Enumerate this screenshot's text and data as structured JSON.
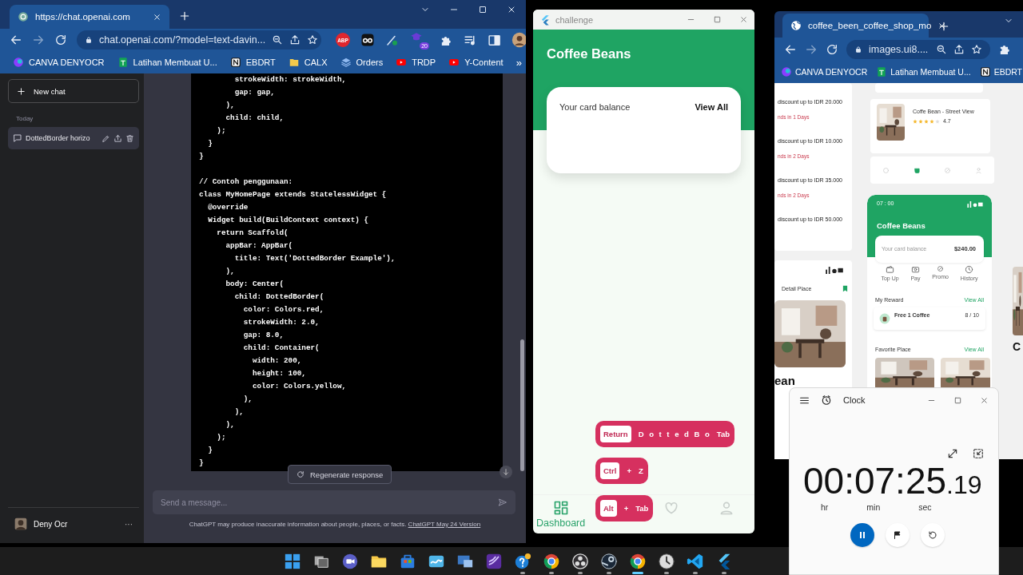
{
  "chat_browser": {
    "tab": {
      "title": "https://chat.openai.com"
    },
    "address": "chat.openai.com/?model=text-davin...",
    "extensions": [
      {
        "kind": "abp",
        "label": "ABP"
      },
      {
        "kind": "reader"
      },
      {
        "kind": "pen"
      },
      {
        "kind": "hat",
        "label": "20"
      },
      {
        "kind": "puzzle"
      },
      {
        "kind": "playlist"
      },
      {
        "kind": "sidepanel"
      },
      {
        "kind": "avatar"
      }
    ],
    "bookmarks": [
      {
        "kind": "canva",
        "label": "CANVA DENYOCR"
      },
      {
        "kind": "sheets",
        "label": "Latihan Membuat U..."
      },
      {
        "kind": "notion",
        "label": "EBDRT"
      },
      {
        "kind": "folder",
        "label": "CALX"
      },
      {
        "kind": "layers",
        "label": "Orders"
      },
      {
        "kind": "youtube",
        "label": "TRDP"
      },
      {
        "kind": "youtube",
        "label": "Y-Content"
      }
    ],
    "bookmarks_more": "»"
  },
  "chatgpt": {
    "new_chat": "New chat",
    "section": "Today",
    "chats": [
      {
        "title": "DottedBorder horizo",
        "selected": true
      }
    ],
    "user": "Deny Ocr",
    "user_menu": "···",
    "code": [
      [
        "        strokeWidth: strokeWidth,",
        "        gap: gap,",
        "      ),",
        "      child: child,",
        "    );",
        "  }",
        "}"
      ],
      [
        "// Contoh penggunaan:",
        "class MyHomePage extends StatelessWidget {",
        "  @override",
        "  Widget build(BuildContext context) {",
        "    return Scaffold(",
        "      appBar: AppBar(",
        "        title: Text('DottedBorder Example'),",
        "      ),",
        "      body: Center(",
        "        child: DottedBorder(",
        "          color: Colors.red,",
        "          strokeWidth: 2.0,",
        "          gap: 8.0,",
        "          child: Container(",
        "            width: 200,",
        "            height: 100,",
        "            color: Colors.yellow,",
        "          ),",
        "        ),",
        "      ),",
        "    );",
        "  }",
        "}"
      ]
    ],
    "regenerate": "Regenerate response",
    "input": {
      "placeholder": "Send a message..."
    },
    "disclaimer": "ChatGPT may produce inaccurate information about people, places, or facts.",
    "version_link": "ChatGPT May 24 Version"
  },
  "flutter_window": {
    "title": "challenge",
    "app_title": "Coffee Beans",
    "balance_label": "Your card balance",
    "view_all": "View All",
    "nav": [
      {
        "kind": "dashboard",
        "label": "Dashboard",
        "selected": true
      },
      {
        "kind": "heart",
        "selected": false
      },
      {
        "kind": "user",
        "selected": false
      }
    ],
    "key_overlays": [
      [
        {
          "kind": "key",
          "text": "Return"
        },
        {
          "kind": "text",
          "text": "D o t t e d B o"
        },
        {
          "kind": "text",
          "text": "Tab"
        }
      ],
      [
        {
          "kind": "key",
          "text": "Ctrl"
        },
        {
          "kind": "text",
          "text": "+"
        },
        {
          "kind": "text",
          "text": "Z"
        }
      ],
      [
        {
          "kind": "key",
          "text": "Alt"
        },
        {
          "kind": "text",
          "text": "+"
        },
        {
          "kind": "text",
          "text": "Tab"
        }
      ]
    ]
  },
  "mockup_browser": {
    "tab": {
      "title": "coffee_been_coffee_shop_mo"
    },
    "address": "images.ui8....",
    "bookmarks": [
      {
        "kind": "canva",
        "label": "CANVA DENYOCR"
      },
      {
        "kind": "sheets",
        "label": "Latihan Membuat U..."
      },
      {
        "kind": "notion",
        "label": "EBDRT"
      }
    ],
    "mockup": {
      "promos": [
        {
          "title": "discount up to IDR 20.000",
          "expiry": "nds in 1 Days"
        },
        {
          "title": "discount up to IDR 10.000",
          "expiry": "nds in 2 Days"
        },
        {
          "title": "discount up to IDR 35.000",
          "expiry": "nds in 2 Days"
        },
        {
          "title": "discount up to IDR 50.000"
        }
      ],
      "detail_title": "Detail Place",
      "detail_caption": "ean",
      "place": {
        "name": "Coffe Bean - Street View",
        "stars": 4,
        "rating": "4.7"
      },
      "nav": [
        {
          "kind": "home",
          "selected": false
        },
        {
          "kind": "cup",
          "selected": true
        },
        {
          "kind": "promo",
          "selected": false
        },
        {
          "kind": "user",
          "selected": false
        }
      ],
      "phone": {
        "time": "07 : 00",
        "title": "Coffee Beans",
        "balance_label": "Your card balance",
        "balance": "$240.00",
        "actions": [
          {
            "kind": "wallet",
            "label": "Top Up"
          },
          {
            "kind": "card",
            "label": "Pay"
          },
          {
            "kind": "promo",
            "label": "Promo"
          },
          {
            "kind": "clock",
            "label": "History"
          }
        ],
        "reward_title": "My Reward",
        "reward_link": "View All",
        "reward": {
          "name": "Free 1 Coffee",
          "progress": "8 / 10"
        },
        "favorites_title": "Favorite Place",
        "favorites_link": "View All"
      },
      "edge_caption": "C"
    }
  },
  "clock": {
    "title": "Clock",
    "time": "00:07:25",
    "fraction": ".19",
    "units": [
      "hr",
      "min",
      "sec"
    ],
    "running": true
  },
  "taskbar": {
    "apps": [
      {
        "kind": "windows",
        "open": false,
        "selected": false
      },
      {
        "kind": "taskview",
        "open": false,
        "selected": false
      },
      {
        "kind": "teams",
        "open": false,
        "selected": false
      },
      {
        "kind": "files",
        "open": false,
        "selected": false
      },
      {
        "kind": "store",
        "open": false,
        "selected": false
      },
      {
        "kind": "mdp",
        "open": false,
        "selected": false
      },
      {
        "kind": "remote",
        "open": false,
        "selected": false
      },
      {
        "kind": "studio",
        "open": false,
        "selected": false
      },
      {
        "kind": "help",
        "open": true,
        "selected": false
      },
      {
        "kind": "chrome",
        "open": true,
        "selected": false
      },
      {
        "kind": "obs",
        "open": true,
        "selected": false
      },
      {
        "kind": "steam",
        "open": true,
        "selected": false
      },
      {
        "kind": "chrome",
        "open": true,
        "selected": true
      },
      {
        "kind": "clock",
        "open": true,
        "selected": false
      },
      {
        "kind": "vscode",
        "open": true,
        "selected": false
      },
      {
        "kind": "flutter",
        "open": true,
        "selected": false
      }
    ]
  }
}
